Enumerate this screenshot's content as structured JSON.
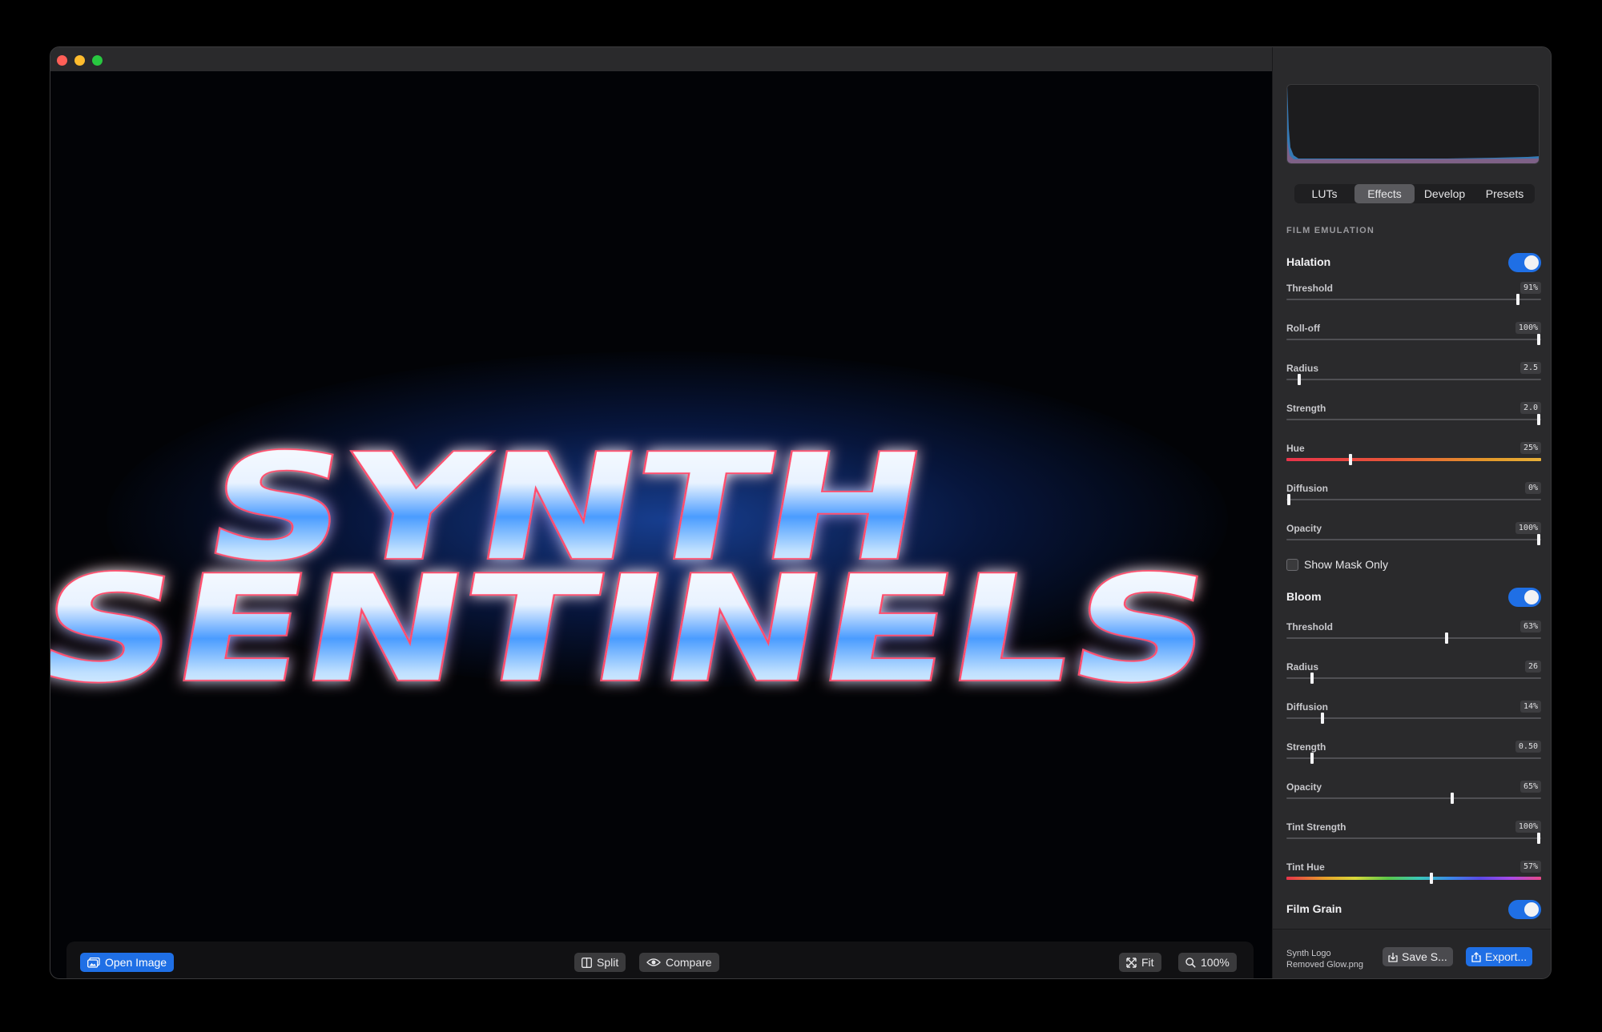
{
  "canvas": {
    "artwork_line1": "SYNTH",
    "artwork_line2": "SENTINELS"
  },
  "toolbar": {
    "open_image": "Open Image",
    "split": "Split",
    "compare": "Compare",
    "fit": "Fit",
    "zoom": "100%"
  },
  "tabs": [
    {
      "label": "LUTs",
      "active": false
    },
    {
      "label": "Effects",
      "active": true
    },
    {
      "label": "Develop",
      "active": false
    },
    {
      "label": "Presets",
      "active": false
    }
  ],
  "section_header": "FILM EMULATION",
  "halation": {
    "title": "Halation",
    "enabled": true,
    "params": [
      {
        "label": "Threshold",
        "value": "91%",
        "level": 0.91
      },
      {
        "label": "Roll-off",
        "value": "100%",
        "level": 1.0
      },
      {
        "label": "Radius",
        "value": "2.5",
        "level": 0.05
      },
      {
        "label": "Strength",
        "value": "2.0",
        "level": 1.0
      },
      {
        "label": "Hue",
        "value": "25%",
        "level": 0.25
      },
      {
        "label": "Diffusion",
        "value": "0%",
        "level": 0.0
      },
      {
        "label": "Opacity",
        "value": "100%",
        "level": 1.0
      }
    ],
    "show_mask_only": "Show Mask Only",
    "show_mask_checked": false
  },
  "bloom": {
    "title": "Bloom",
    "enabled": true,
    "params": [
      {
        "label": "Threshold",
        "value": "63%",
        "level": 0.63
      },
      {
        "label": "Radius",
        "value": "26",
        "level": 0.1
      },
      {
        "label": "Diffusion",
        "value": "14%",
        "level": 0.14
      },
      {
        "label": "Strength",
        "value": "0.50",
        "level": 0.1
      },
      {
        "label": "Opacity",
        "value": "65%",
        "level": 0.65
      },
      {
        "label": "Tint Strength",
        "value": "100%",
        "level": 1.0
      },
      {
        "label": "Tint Hue",
        "value": "57%",
        "level": 0.57
      }
    ]
  },
  "film_grain": {
    "title": "Film Grain",
    "enabled": true
  },
  "footer": {
    "filename_line1": "Synth Logo",
    "filename_line2": "Removed Glow.png",
    "save": "Save S...",
    "export": "Export..."
  },
  "colors": {
    "accent": "#1f6fe5",
    "window_bg": "#1c1c1e",
    "sidebar_bg": "#2a2a2c",
    "glow_blue": "#2a6cff",
    "text_red_edge": "#ff4d6d"
  }
}
